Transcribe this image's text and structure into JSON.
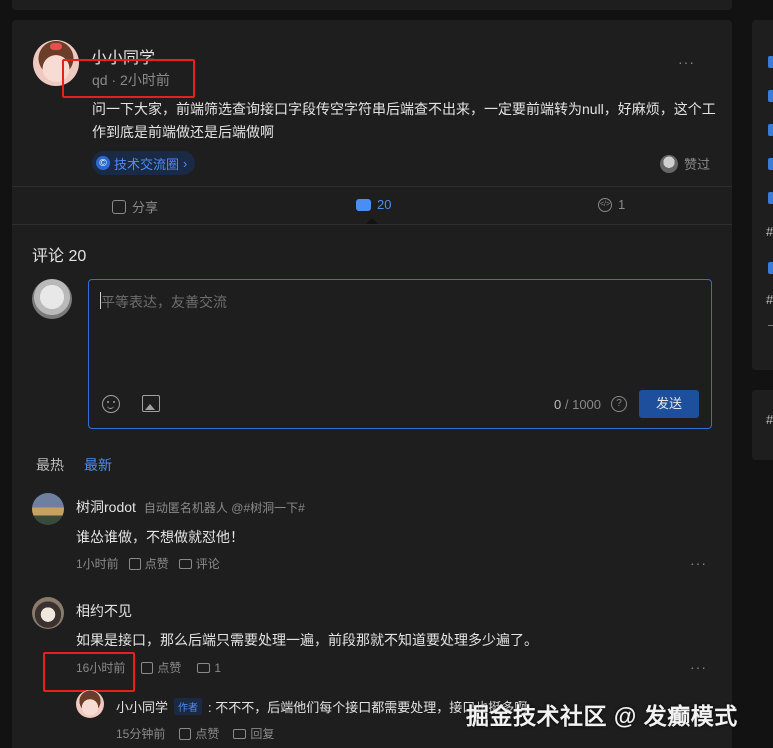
{
  "post": {
    "author": "小小同学",
    "tag_label": "qd",
    "time": "2小时前",
    "content": "问一下大家，前端筛选查询接口字段传空字符串后端查不出来，一定要前端转为null，好麻烦，这个工作到底是前端做还是后端做啊",
    "topic": "技术交流圈",
    "liked_label": "赞过"
  },
  "actions": {
    "share": "分享",
    "comments": "20",
    "likes": "1"
  },
  "comments_section": {
    "title": "评论 20",
    "input_placeholder": "平等表达，友善交流",
    "counter_current": "0",
    "counter_max": "1000",
    "send_label": "发送",
    "sort_hot": "最热",
    "sort_new": "最新"
  },
  "comments": [
    {
      "name": "树洞rodot",
      "sub": "自动匿名机器人 @#树洞一下#",
      "text": "谁怂谁做，不想做就怼他！",
      "time": "1小时前",
      "like_label": "点赞",
      "reply_label": "评论"
    },
    {
      "name": "相约不见",
      "text": "如果是接口，那么后端只需要处理一遍，前段那就不知道要处理多少遍了。",
      "time": "16小时前",
      "like_label": "点赞",
      "reply_count": "1"
    }
  ],
  "reply": {
    "name": "小小同学",
    "badge": "作者",
    "text": ": 不不不，后端他们每个接口都需要处理，",
    "text_tail": "接口也挺多啊",
    "time": "15分钟前",
    "like_label": "点赞",
    "reply_label": "回复"
  },
  "watermark": "掘金技术社区 @ 发癫模式",
  "colors": {
    "accent": "#4b8df5",
    "highlight_box": "#e6201d",
    "background": "#121212",
    "card": "#1e1e1e"
  },
  "icons": [
    "more-icon",
    "share-icon",
    "comment-icon",
    "like-icon",
    "emoji-icon",
    "image-icon",
    "help-icon"
  ]
}
